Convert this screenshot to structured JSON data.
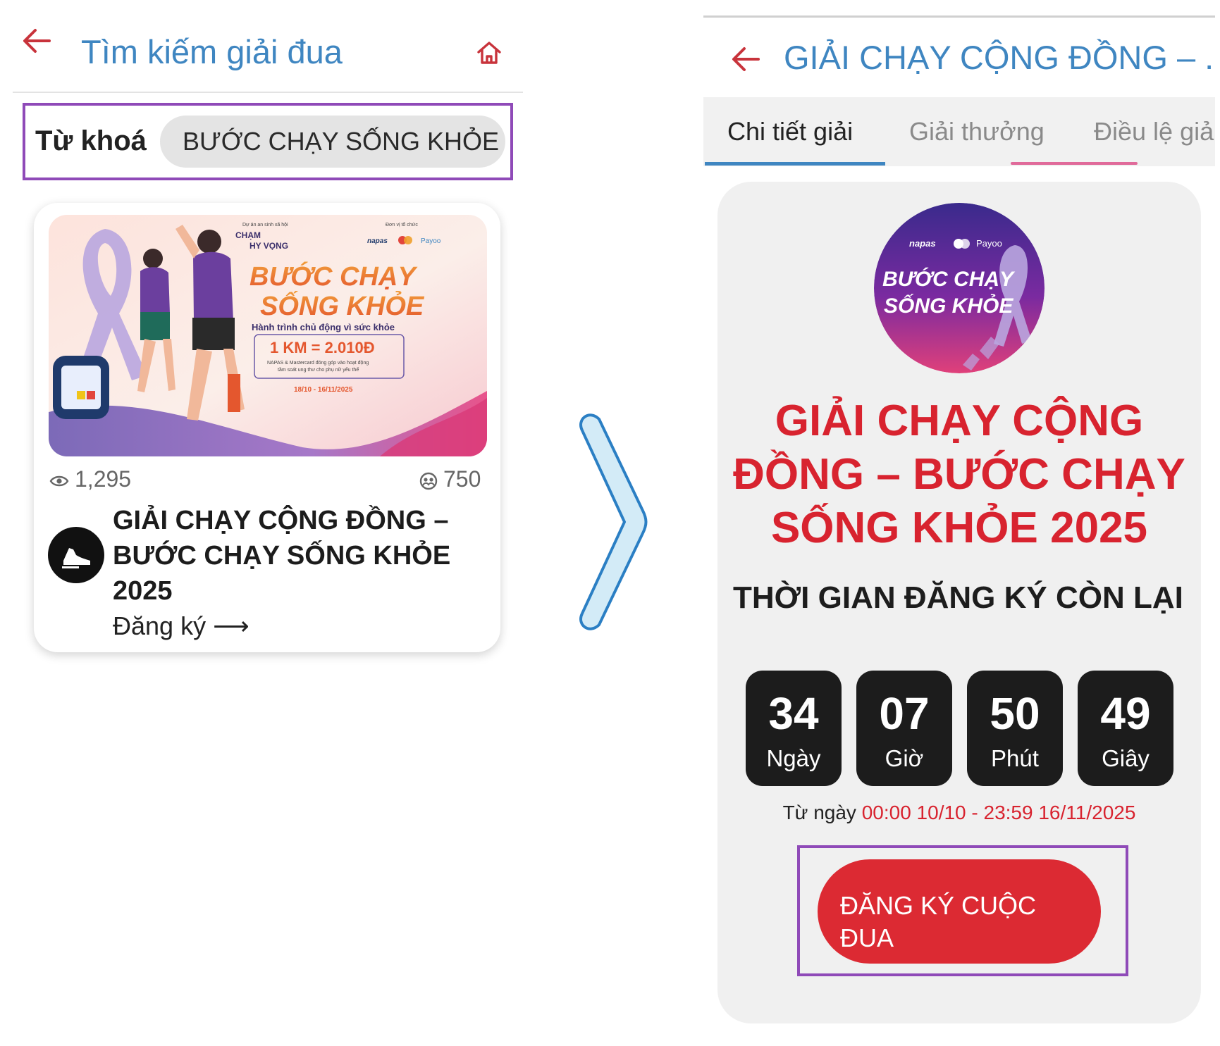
{
  "left_screen": {
    "header": {
      "title": "Tìm kiếm giải đua",
      "back_icon": "arrow-left-icon",
      "home_icon": "home-icon"
    },
    "search": {
      "label": "Từ khoá",
      "value": "BƯỚC CHẠY SỐNG KHỎE"
    },
    "result_card": {
      "banner": {
        "project_caption": "Dự án an sinh xã hội",
        "project_name_line1": "CHẠM",
        "project_name_line2": "HY VỌNG",
        "organizer_caption": "Đơn vị tổ chức",
        "sponsors": [
          "napas",
          "mastercard",
          "Payoo"
        ],
        "headline_line1": "BƯỚC CHẠY",
        "headline_line2": "SỐNG KHỎE",
        "subtitle": "Hành trình chủ động vì sức khỏe",
        "pledge": "1 KM = 2.010Đ",
        "pledge_note_line1": "NAPAS & Mastercard đóng góp vào hoạt động",
        "pledge_note_line2": "tầm soát ung thư cho phụ nữ yếu thế",
        "dates": "18/10 - 16/11/2025"
      },
      "views": "1,295",
      "participants": "750",
      "title": "GIẢI CHẠY CỘNG ĐỒNG – BƯỚC CHẠY SỐNG KHỎE 2025",
      "register_link": "Đăng ký ⟶"
    }
  },
  "right_screen": {
    "header": {
      "title": "GIẢI CHẠY CỘNG ĐỒNG – ...",
      "back_icon": "arrow-left-icon"
    },
    "tabs": [
      {
        "label": "Chi tiết giải",
        "active": true
      },
      {
        "label": "Giải thưởng",
        "active": false
      },
      {
        "label": "Điều lệ giả",
        "active": false
      }
    ],
    "logo": {
      "sponsors": [
        "napas",
        "mastercard",
        "Payoo"
      ],
      "line1": "BƯỚC CHẠY",
      "line2": "SỐNG KHỎE"
    },
    "race_title": "GIẢI CHẠY CỘNG ĐỒNG – BƯỚC CHẠY SỐNG KHỎE 2025",
    "countdown": {
      "label": "THỜI GIAN ĐĂNG KÝ CÒN LẠI",
      "days": "34",
      "days_unit": "Ngày",
      "hours": "07",
      "hours_unit": "Giờ",
      "minutes": "50",
      "minutes_unit": "Phút",
      "seconds": "49",
      "seconds_unit": "Giây"
    },
    "date_range": {
      "label": "Từ ngày",
      "value": "00:00 10/10 - 23:59 16/11/2025"
    },
    "register_button": "ĐĂNG KÝ CUỘC ĐUA"
  },
  "colors": {
    "accent_blue": "#3f86c1",
    "accent_red": "#d8232f",
    "highlight_purple": "#8f4ab8",
    "button_red": "#dc2a33"
  }
}
